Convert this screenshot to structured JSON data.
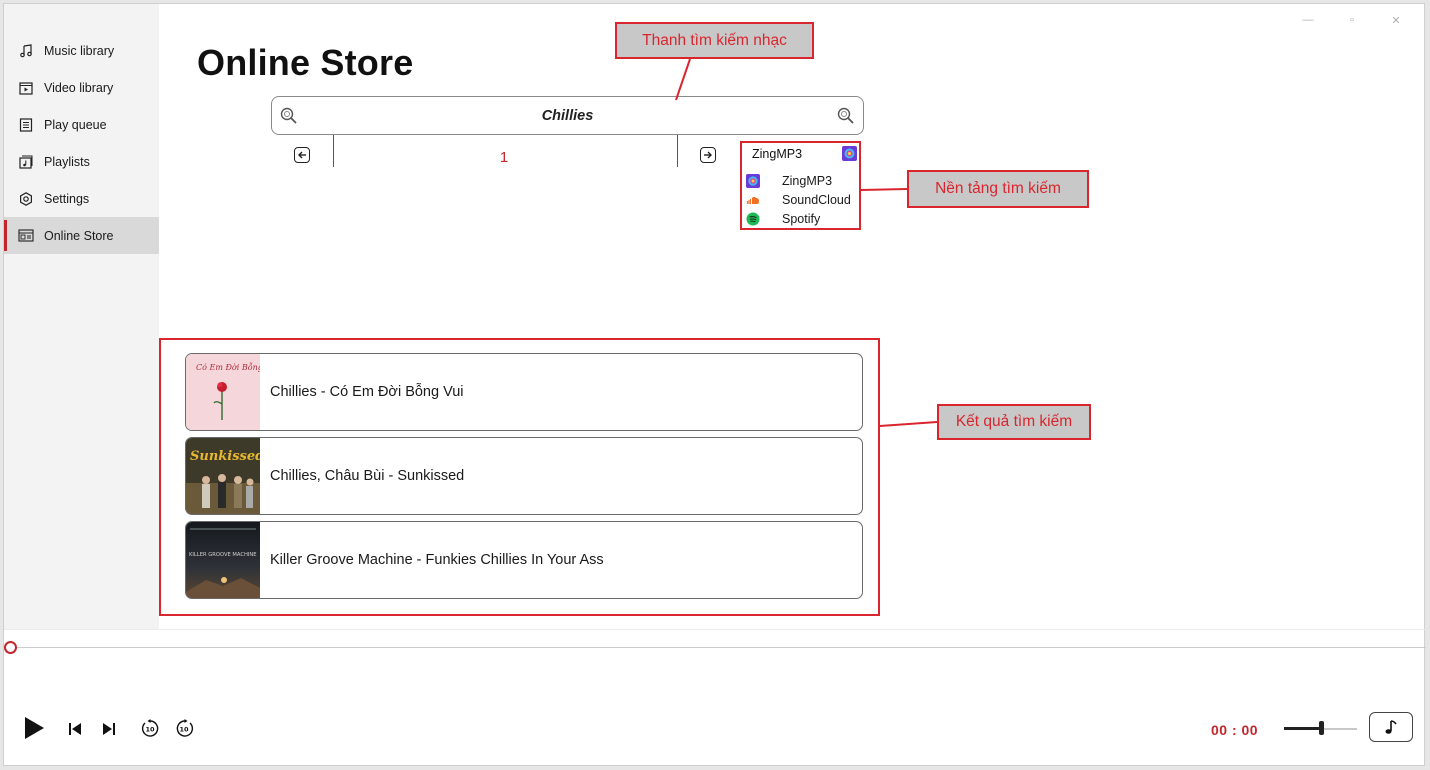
{
  "window": {
    "minimize_icon": "minimize-icon",
    "maximize_icon": "maximize-icon",
    "close_icon": "close-icon"
  },
  "sidebar": {
    "items": [
      {
        "label": "Music library",
        "icon": "music-note-icon"
      },
      {
        "label": "Video library",
        "icon": "video-icon"
      },
      {
        "label": "Play queue",
        "icon": "queue-list-icon"
      },
      {
        "label": "Playlists",
        "icon": "playlist-icon"
      },
      {
        "label": "Settings",
        "icon": "gear-icon"
      },
      {
        "label": "Online Store",
        "icon": "store-icon",
        "active": true
      }
    ]
  },
  "page": {
    "title": "Online Store"
  },
  "search": {
    "value": "Chillies"
  },
  "pager": {
    "page": "1"
  },
  "platform": {
    "selected": "ZingMP3",
    "options": [
      {
        "label": "ZingMP3",
        "icon": "zingmp3-icon"
      },
      {
        "label": "SoundCloud",
        "icon": "soundcloud-icon"
      },
      {
        "label": "Spotify",
        "icon": "spotify-icon"
      }
    ]
  },
  "annotations": {
    "search_bar": "Thanh tìm kiếm nhạc",
    "platform": "Nền tảng tìm kiếm",
    "results": "Kết quả tìm kiếm"
  },
  "results": [
    {
      "title": "Chillies - Có Em Đời Bỗng Vui",
      "thumb_text": "Có Em Đời Bỗng Vui"
    },
    {
      "title": "Chillies, Châu Bùi - Sunkissed",
      "thumb_text": "Sunkissed"
    },
    {
      "title": "Killer Groove Machine - Funkies Chillies In Your Ass",
      "thumb_text": "KILLER GROOVE MACHINE"
    }
  ],
  "player": {
    "time": "00 : 00",
    "progress": 0,
    "volume": 0.5
  },
  "colors": {
    "accent": "#c4262e",
    "annotation_red": "#d9262e",
    "annotation_bg": "#c8c8c8"
  }
}
